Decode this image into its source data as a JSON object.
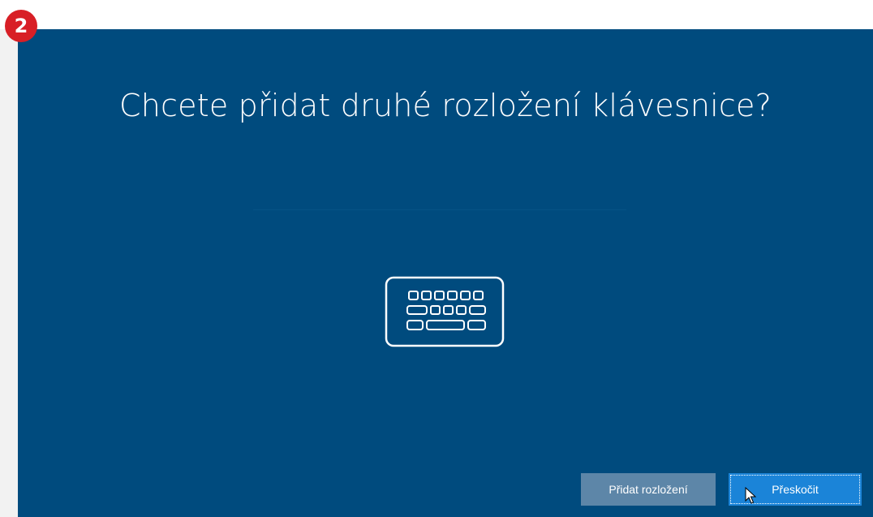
{
  "step_badge": "2",
  "title": "Chcete přidat druhé rozložení klávesnice?",
  "icon": "keyboard-icon",
  "buttons": {
    "add_layout": "Přidat rozložení",
    "skip": "Přeskočit"
  },
  "colors": {
    "background": "#004b7e",
    "primary_button": "#1b84d8",
    "secondary_button": "#5d86a8",
    "badge": "#d81f26"
  }
}
